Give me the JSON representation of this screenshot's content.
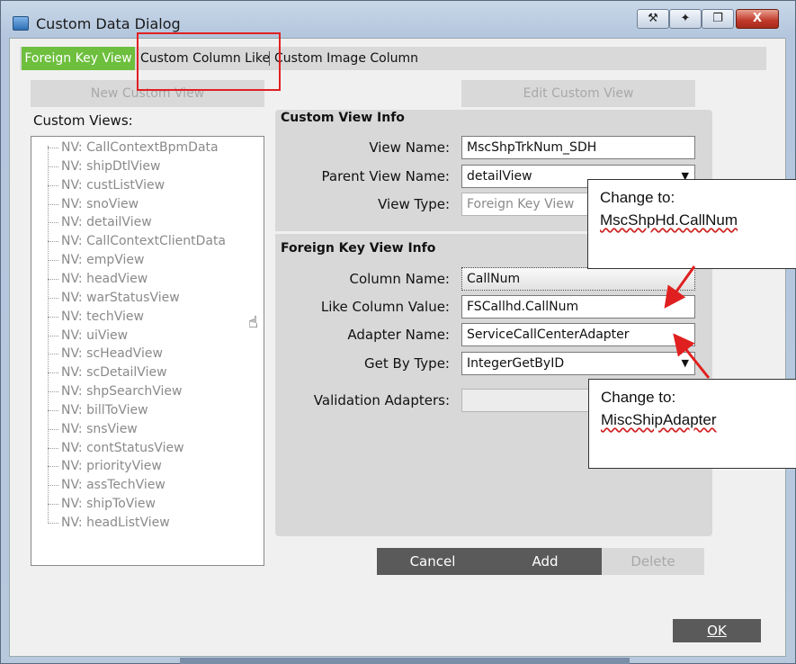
{
  "window": {
    "title": "Custom Data Dialog",
    "controls": {
      "pin": "⚒",
      "move": "✦",
      "restore": "❐",
      "close": "X"
    }
  },
  "tabs": [
    {
      "label": "Foreign Key View",
      "active": true
    },
    {
      "label": "Custom Column Like",
      "active": false
    },
    {
      "label": "Custom Image Column",
      "active": false
    }
  ],
  "buttons": {
    "new_custom_view": "New Custom View",
    "edit_custom_view": "Edit Custom View",
    "cancel": "Cancel",
    "add": "Add",
    "delete": "Delete",
    "ok": "OK"
  },
  "custom_views": {
    "label": "Custom Views:",
    "items": [
      "NV: CallContextBpmData",
      "NV: shipDtlView",
      "NV: custListView",
      "NV: snoView",
      "NV: detailView",
      "NV: CallContextClientData",
      "NV: empView",
      "NV: headView",
      "NV: warStatusView",
      "NV: techView",
      "NV: uiView",
      "NV: scHeadView",
      "NV: scDetailView",
      "NV: shpSearchView",
      "NV: billToView",
      "NV: snsView",
      "NV: contStatusView",
      "NV: priorityView",
      "NV: assTechView",
      "NV: shipToView",
      "NV: headListView"
    ]
  },
  "custom_view_info": {
    "heading": "Custom View Info",
    "view_name": {
      "label": "View Name:",
      "value": "MscShpTrkNum_SDH"
    },
    "parent_view_name": {
      "label": "Parent View Name:",
      "value": "detailView"
    },
    "view_type": {
      "label": "View Type:",
      "value": "Foreign Key View"
    }
  },
  "foreign_key_view_info": {
    "heading": "Foreign Key View Info",
    "column_name": {
      "label": "Column Name:",
      "value": "CallNum"
    },
    "like_column_value": {
      "label": "Like Column Value:",
      "value": "FSCallhd.CallNum"
    },
    "adapter_name": {
      "label": "Adapter Name:",
      "value": "ServiceCallCenterAdapter"
    },
    "get_by_type": {
      "label": "Get By Type:",
      "value": "IntegerGetByID"
    },
    "validation_adapters": {
      "label": "Validation Adapters:",
      "value": ""
    }
  },
  "callouts": [
    {
      "heading": "Change to:",
      "value": "MscShpHd.CallNum"
    },
    {
      "heading": "Change to:",
      "value": "MiscShipAdapter"
    }
  ],
  "colors": {
    "active_tab": "#6dbf3d",
    "highlight": "#e02020",
    "dark_button": "#5a5a5a"
  }
}
